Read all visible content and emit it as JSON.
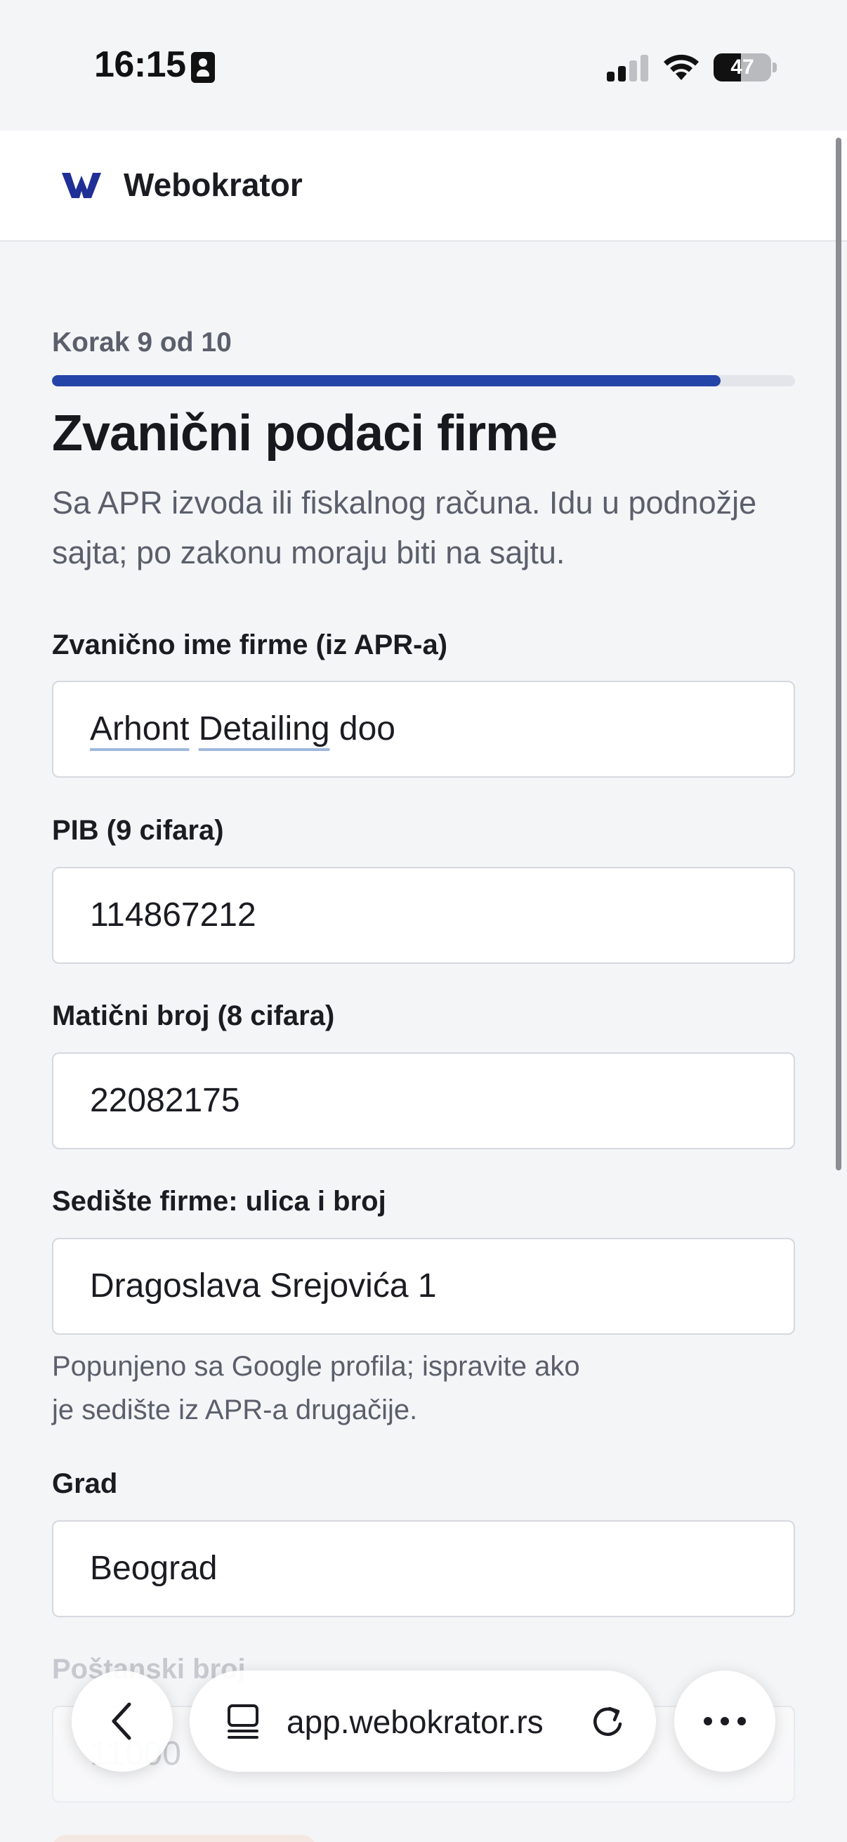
{
  "status_bar": {
    "time": "16:15",
    "battery_percent": "47",
    "battery_level": 0.47,
    "icons": [
      "id-card-icon",
      "cellular-signal-icon",
      "wifi-icon",
      "battery-icon"
    ]
  },
  "header": {
    "brand_name": "Webokrator",
    "logo_icon": "webokrator-w-logo",
    "brand_color": "#1f2f96"
  },
  "wizard": {
    "step_label": "Korak 9 od 10",
    "progress": 0.9,
    "progress_color": "#2444a8",
    "title": "Zvanični podaci firme",
    "subtitle": "Sa APR izvoda ili fiskalnog računa. Idu u podnožje sajta; po zakonu moraju biti na sajtu."
  },
  "fields": {
    "company_name": {
      "label": "Zvanično ime firme (iz APR-a)",
      "value_part1": "Arhont",
      "value_part2": "Detailing",
      "value_part3": "doo"
    },
    "pib": {
      "label": "PIB (9 cifara)",
      "value": "114867212"
    },
    "registration_number": {
      "label": "Matični broj (8 cifara)",
      "value": "22082175"
    },
    "address": {
      "label": "Sedište firme: ulica i broj",
      "value": "Dragoslava Srejovića 1",
      "help_line1": "Popunjeno sa Google profila; ispravite ako",
      "help_line2": "je sedište iz APR-a drugačije."
    },
    "city": {
      "label": "Grad",
      "value": "Beograd"
    },
    "postal_code": {
      "label": "Poštanski broj",
      "value": "11000"
    }
  },
  "browser": {
    "url": "app.webokrator.rs",
    "icons": [
      "back-chevron-icon",
      "tab-overview-icon",
      "reload-icon",
      "more-options-icon"
    ]
  }
}
